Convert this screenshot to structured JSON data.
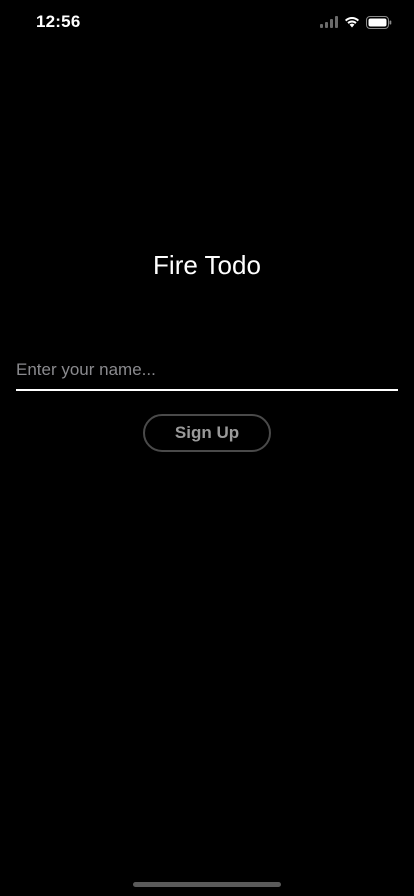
{
  "status_bar": {
    "time": "12:56",
    "icons": [
      "signal-icon",
      "wifi-icon",
      "battery-icon"
    ]
  },
  "app": {
    "title": "Fire Todo"
  },
  "form": {
    "name_value": "",
    "name_placeholder": "Enter your name...",
    "signup_label": "Sign Up"
  },
  "colors": {
    "background": "#000000",
    "text": "#ffffff",
    "placeholder": "#8a8a8e",
    "button_border": "#4a4a4a",
    "button_text": "#9a9a9a"
  }
}
